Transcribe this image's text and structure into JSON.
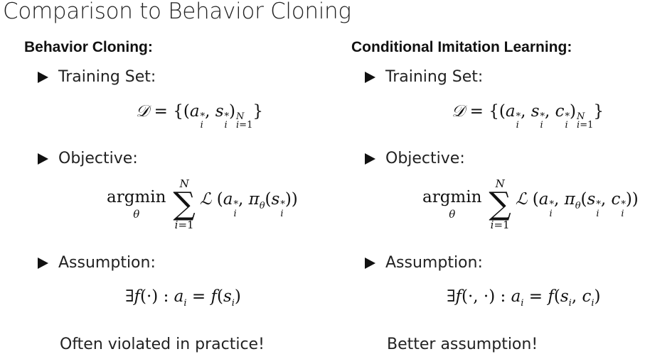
{
  "title": "Comparison to Behavior Cloning",
  "left": {
    "heading": "Behavior Cloning:",
    "bullets": [
      "Training Set:",
      "Objective:",
      "Assumption:"
    ],
    "note": "Often violated in practice!"
  },
  "right": {
    "heading": "Conditional Imitation Learning:",
    "bullets": [
      "Training Set:",
      "Objective:",
      "Assumption:"
    ],
    "note": "Better assumption!"
  }
}
